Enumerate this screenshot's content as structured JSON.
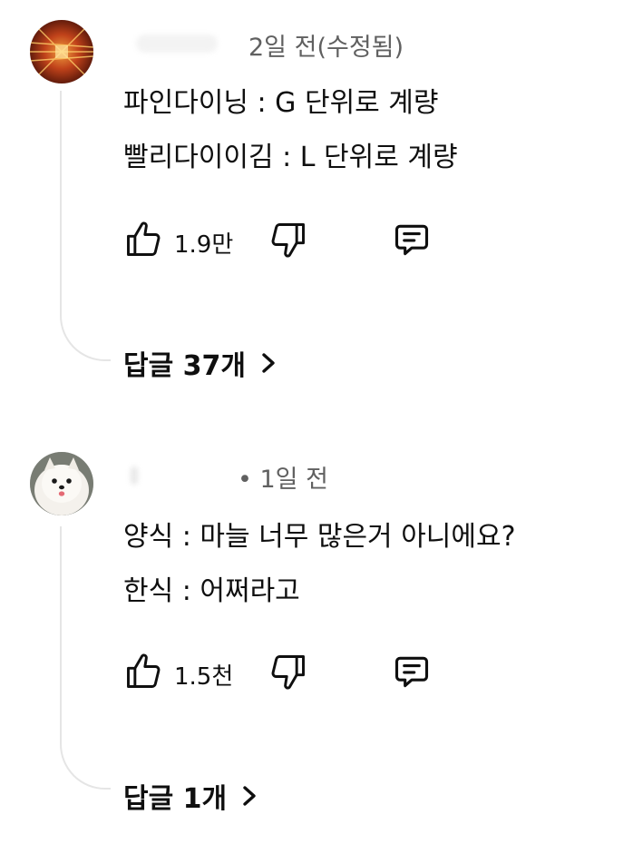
{
  "comments": [
    {
      "timestamp": "2일 전(수정됨)",
      "lines": [
        "파인다이닝 : G 단위로 계량",
        "빨리다이이김 : L 단위로 계량"
      ],
      "likes": "1.9만",
      "replies_label": "답글 37개",
      "avatar_icon": "red-corridor-avatar"
    },
    {
      "timestamp": "• 1일 전",
      "lines": [
        "양식 : 마늘 너무 많은거 아니에요?",
        "한식 : 어쩌라고"
      ],
      "likes": "1.5천",
      "replies_label": "답글 1개",
      "avatar_icon": "pomeranian-dog-avatar"
    }
  ],
  "icons": {
    "like": "thumbs-up-icon",
    "dislike": "thumbs-down-icon",
    "reply": "comment-reply-icon",
    "chevron": "chevron-right-icon"
  }
}
